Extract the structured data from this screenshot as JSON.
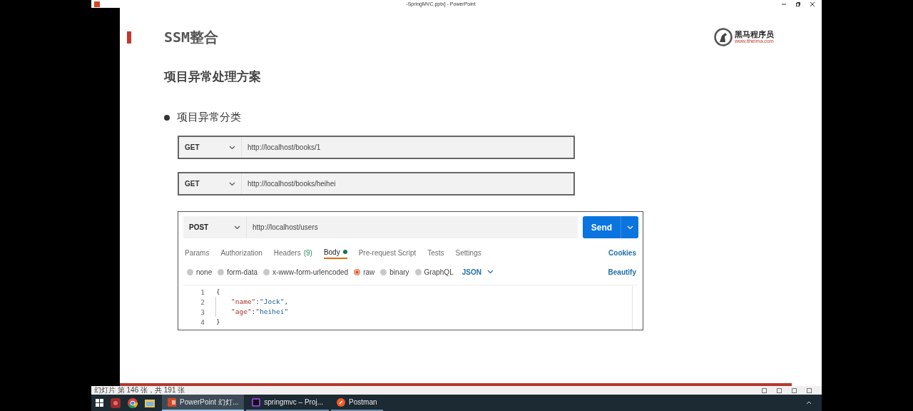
{
  "window": {
    "title": "-SpringMVC.pptx] - PowerPoint"
  },
  "slide": {
    "title": "SSM整合",
    "logo": {
      "name": "黑马程序员",
      "url": "www.itheima.com"
    },
    "heading": "项目异常处理方案",
    "bullets": [
      "项目异常分类"
    ],
    "requests": [
      {
        "method": "GET",
        "url": "http://localhost/books/1"
      },
      {
        "method": "GET",
        "url": "http://localhost/books/heihei"
      }
    ],
    "postman": {
      "method": "POST",
      "url": "http://localhost/users",
      "send": "Send",
      "tabs": [
        {
          "label": "Params",
          "selected": false,
          "dot": false
        },
        {
          "label": "Authorization",
          "selected": false,
          "dot": false
        },
        {
          "label": "Headers",
          "count": "(9)",
          "selected": false,
          "dot": false
        },
        {
          "label": "Body",
          "selected": true,
          "dot": true
        },
        {
          "label": "Pre-request Script",
          "selected": false,
          "dot": false
        },
        {
          "label": "Tests",
          "selected": false,
          "dot": false
        },
        {
          "label": "Settings",
          "selected": false,
          "dot": false
        }
      ],
      "cookies": "Cookies",
      "body_types": [
        {
          "label": "none",
          "selected": false
        },
        {
          "label": "form-data",
          "selected": false
        },
        {
          "label": "x-www-form-urlencoded",
          "selected": false
        },
        {
          "label": "raw",
          "selected": true
        },
        {
          "label": "binary",
          "selected": false
        },
        {
          "label": "GraphQL",
          "selected": false
        }
      ],
      "format": "JSON",
      "beautify": "Beautify",
      "code": [
        {
          "number": "1",
          "indented": false,
          "tokens": [
            {
              "kind": "punct",
              "text": "{"
            }
          ]
        },
        {
          "number": "2",
          "indented": true,
          "tokens": [
            {
              "kind": "key",
              "text": "\"name\""
            },
            {
              "kind": "punct",
              "text": ":"
            },
            {
              "kind": "string",
              "text": "\"Jock\""
            },
            {
              "kind": "punct",
              "text": ","
            }
          ]
        },
        {
          "number": "3",
          "indented": true,
          "tokens": [
            {
              "kind": "key",
              "text": "\"age\""
            },
            {
              "kind": "punct",
              "text": ":"
            },
            {
              "kind": "string",
              "text": "\"heihei\""
            }
          ]
        },
        {
          "number": "4",
          "indented": false,
          "tokens": [
            {
              "kind": "punct",
              "text": "}"
            }
          ]
        }
      ]
    }
  },
  "status_bar": {
    "text": "幻灯片 第 146 张，共 191 张"
  },
  "taskbar": {
    "apps": [
      {
        "label": "PowerPoint 幻灯...",
        "kind": "powerpoint",
        "selected": true
      },
      {
        "label": "springmvc – Proj...",
        "kind": "ide",
        "selected": false
      },
      {
        "label": "Postman",
        "kind": "postman",
        "selected": false
      }
    ]
  }
}
